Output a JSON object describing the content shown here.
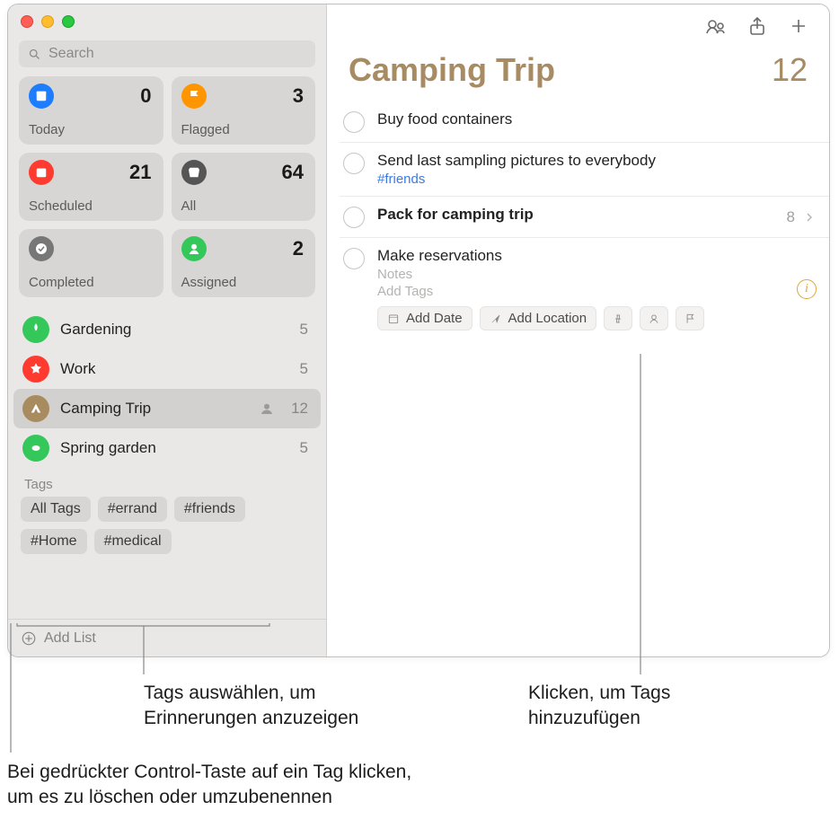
{
  "search": {
    "placeholder": "Search"
  },
  "smart_lists": [
    {
      "label": "Today",
      "count": "0",
      "iconClass": "ic-blue",
      "iconSvg": "<rect x='5' y='5' width='14' height='14' rx='2'/><rect x='5' y='5' width='14' height='4'/>"
    },
    {
      "label": "Flagged",
      "count": "3",
      "iconClass": "ic-orange",
      "iconSvg": "<path d='M7 4v16M7 4h11l-3 4 3 4H7'/>"
    },
    {
      "label": "Scheduled",
      "count": "21",
      "iconClass": "ic-red",
      "iconSvg": "<rect x='5' y='6' width='14' height='13' rx='2'/><path d='M5 10h14M9 4v4M15 4v4'/>"
    },
    {
      "label": "All",
      "count": "64",
      "iconClass": "ic-black",
      "iconSvg": "<path d='M4 8h16l-2 11H6z'/><path d='M4 8l2-3h12l2 3'/>"
    },
    {
      "label": "Completed",
      "count": "",
      "iconClass": "ic-gray",
      "iconSvg": "<circle cx='12' cy='12' r='8'/><path d='M8 12l3 3 5-6' stroke='#777' stroke-width='2' fill='none'/>"
    },
    {
      "label": "Assigned",
      "count": "2",
      "iconClass": "ic-green",
      "iconSvg": "<circle cx='12' cy='9' r='4'/><path d='M5 20c1-4 5-6 7-6s6 2 7 6z'/>"
    }
  ],
  "lists": [
    {
      "name": "Gardening",
      "count": "5",
      "color": "#34c759",
      "selected": false,
      "shared": false,
      "svg": "<path d='M12 3C9 6 9 11 12 14c3-3 3-8 0-11z' fill='#fff'/>"
    },
    {
      "name": "Work",
      "count": "5",
      "color": "#ff3b30",
      "selected": false,
      "shared": false,
      "svg": "<path d='M12 3l2.5 5 5.5.8-4 4 1 5.6L12 16l-5 2.4 1-5.6-4-4 5.5-.8z' fill='#fff'/>"
    },
    {
      "name": "Camping Trip",
      "count": "12",
      "color": "#a98b60",
      "selected": true,
      "shared": true,
      "svg": "<path d='M12 5l-7 13h14z' fill='#fff'/><path d='M12 12l-3 6h6z' fill='#a98b60'/>"
    },
    {
      "name": "Spring garden",
      "count": "5",
      "color": "#34c759",
      "selected": false,
      "shared": false,
      "svg": "<path d='M6 12a6 4 0 0 1 12 0a6 4 0 0 1-12 0' fill='#fff'/><path d='M7 12v-2M10 12v-3M14 12v-3M17 12v-2' stroke='#fff'/>"
    }
  ],
  "tags_header": "Tags",
  "tags": [
    "All Tags",
    "#errand",
    "#friends",
    "#Home",
    "#medical"
  ],
  "add_list_label": "Add List",
  "main": {
    "title": "Camping Trip",
    "count": "12"
  },
  "reminders": [
    {
      "title": "Buy food containers",
      "bold": false
    },
    {
      "title": "Send last sampling pictures to everybody",
      "tag": "#friends",
      "bold": false
    },
    {
      "title": "Pack for camping trip",
      "subcount": "8",
      "chevron": true,
      "bold": true
    },
    {
      "title": "Make reservations",
      "notes_placeholder": "Notes",
      "tags_placeholder": "Add Tags",
      "info": true,
      "expanded": true
    }
  ],
  "actions": {
    "add_date": "Add Date",
    "add_location": "Add Location"
  },
  "callouts": {
    "a": "Tags auswählen, um\nErinnerungen anzuzeigen",
    "b": "Klicken, um Tags\nhinzuzufügen",
    "c": "Bei gedrückter Control-Taste auf ein Tag klicken,\num es zu löschen oder umzubenennen"
  }
}
